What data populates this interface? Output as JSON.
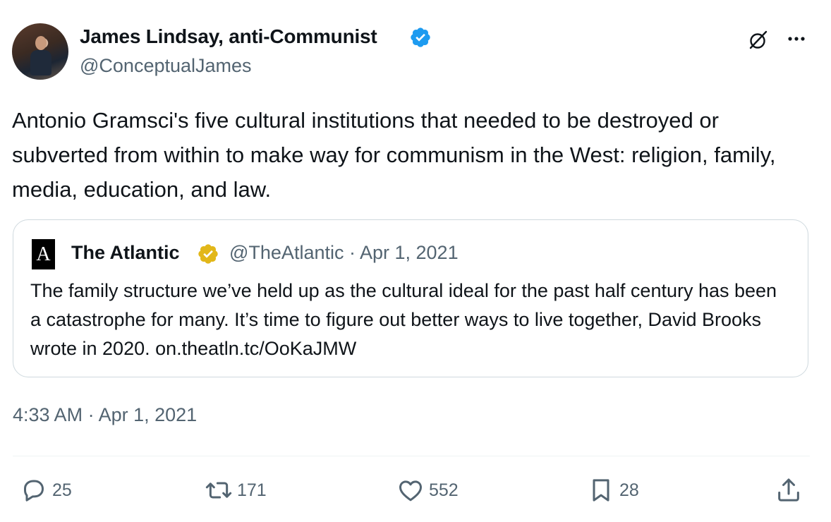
{
  "author": {
    "name": "James Lindsay, anti-Communist",
    "handle": "@ConceptualJames"
  },
  "tweet_text": "Antonio Gramsci's five cultural institutions that needed to be destroyed or subverted from within to make way for communism in the West: religion, family, media, education, and law.",
  "quoted": {
    "logo_letter": "A",
    "name": "The Atlantic",
    "meta": "@TheAtlantic · Apr 1, 2021",
    "text": "The family structure we’ve held up as the cultural ideal for the past half century has been a catastrophe for many. It’s time to figure out better ways to live together, David Brooks wrote in 2020. on.theatln.tc/OoKaJMW"
  },
  "timestamp": "4:33 AM · Apr 1, 2021",
  "actions": {
    "replies": "25",
    "reposts": "171",
    "likes": "552",
    "bookmarks": "28"
  },
  "icons": {
    "verified": "blue-check-badge",
    "quoted_verified": "gold-check-badge",
    "grok": "grok-icon",
    "more": "more-dots-icon",
    "reply": "reply-icon",
    "repost": "repost-icon",
    "like": "heart-icon",
    "bookmark": "bookmark-icon",
    "share": "share-icon"
  },
  "colors": {
    "verified_blue": "#1d9bf0",
    "verified_gold": "#e2b719",
    "secondary_text": "#536471",
    "border": "#cfd9de"
  }
}
